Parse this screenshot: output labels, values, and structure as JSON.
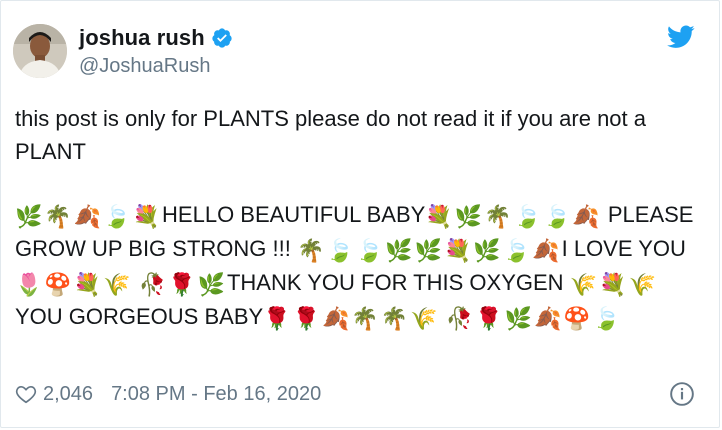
{
  "author": {
    "display_name": "joshua rush",
    "handle": "@JoshuaRush",
    "verified": true
  },
  "tweet": {
    "line1": "this post is only for PLANTS please do not read it if you are not a PLANT",
    "segments": [
      {
        "t": "e",
        "v": "🌿"
      },
      {
        "t": "e",
        "v": "🌴"
      },
      {
        "t": "e",
        "v": "🍂"
      },
      {
        "t": "e",
        "v": "🍃"
      },
      {
        "t": "e",
        "v": "💐"
      },
      {
        "t": "s",
        "v": "HELLO BEAUTIFUL BABY"
      },
      {
        "t": "e",
        "v": "💐"
      },
      {
        "t": "e",
        "v": "🌿"
      },
      {
        "t": "e",
        "v": "🌴"
      },
      {
        "t": "e",
        "v": "🍃"
      },
      {
        "t": "e",
        "v": "🍃"
      },
      {
        "t": "e",
        "v": "🍂"
      },
      {
        "t": "s",
        "v": " PLEASE GROW UP BIG STRONG !!! "
      },
      {
        "t": "e",
        "v": "🌴"
      },
      {
        "t": "e",
        "v": "🍃"
      },
      {
        "t": "e",
        "v": "🍃"
      },
      {
        "t": "e",
        "v": "🌿"
      },
      {
        "t": "e",
        "v": "🌿"
      },
      {
        "t": "e",
        "v": "💐"
      },
      {
        "t": "e",
        "v": "🌿"
      },
      {
        "t": "e",
        "v": "🍃"
      },
      {
        "t": "e",
        "v": "🍂"
      },
      {
        "t": "s",
        "v": "I LOVE YOU"
      },
      {
        "t": "e",
        "v": "🌷"
      },
      {
        "t": "e",
        "v": "🍄"
      },
      {
        "t": "e",
        "v": "💐"
      },
      {
        "t": "e",
        "v": "🌾"
      },
      {
        "t": "s",
        "v": " "
      },
      {
        "t": "e",
        "v": "🥀"
      },
      {
        "t": "e",
        "v": "🌹"
      },
      {
        "t": "e",
        "v": "🌿"
      },
      {
        "t": "s",
        "v": "THANK YOU FOR THIS OXYGEN "
      },
      {
        "t": "e",
        "v": "🌾"
      },
      {
        "t": "e",
        "v": "💐"
      },
      {
        "t": "e",
        "v": "🌾"
      },
      {
        "t": "s",
        "v": "YOU GORGEOUS BABY"
      },
      {
        "t": "e",
        "v": "🌹"
      },
      {
        "t": "e",
        "v": "🌹"
      },
      {
        "t": "e",
        "v": "🍂"
      },
      {
        "t": "e",
        "v": "🌴"
      },
      {
        "t": "e",
        "v": "🌴"
      },
      {
        "t": "e",
        "v": "🌾"
      },
      {
        "t": "s",
        "v": " "
      },
      {
        "t": "e",
        "v": "🥀"
      },
      {
        "t": "e",
        "v": "🌹"
      },
      {
        "t": "e",
        "v": "🌿"
      },
      {
        "t": "e",
        "v": "🍂"
      },
      {
        "t": "e",
        "v": "🍄"
      },
      {
        "t": "e",
        "v": "🍃"
      }
    ]
  },
  "footer": {
    "likes": "2,046",
    "timestamp": "7:08 PM - Feb 16, 2020"
  },
  "colors": {
    "twitter_blue": "#1da1f2",
    "text_primary": "#14171a",
    "text_secondary": "#657786",
    "border": "#e1e8ed"
  },
  "icons": {
    "verified": "verified-badge-icon",
    "brand": "twitter-bird-icon",
    "like": "heart-icon",
    "info": "info-icon"
  }
}
